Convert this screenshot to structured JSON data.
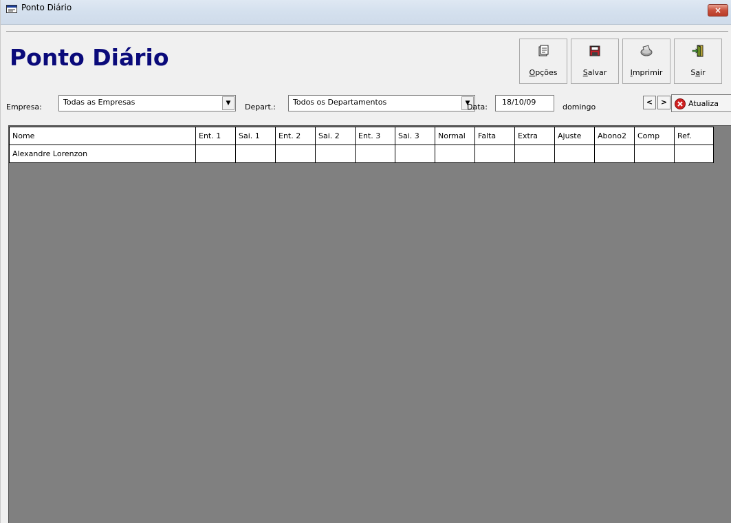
{
  "window": {
    "title": "Ponto Diário",
    "close_label": "×"
  },
  "header": {
    "title": "Ponto Diário",
    "title_color": "#0a0a7a"
  },
  "toolbar": {
    "options": {
      "label_first": "O",
      "label_rest": "pções",
      "icon": "document-gear-icon"
    },
    "save": {
      "label_first": "S",
      "label_rest": "alvar",
      "icon": "floppy-disk-icon"
    },
    "print": {
      "label_first": "I",
      "label_rest": "mprimir",
      "icon": "printer-icon"
    },
    "exit": {
      "label_pre": "S",
      "label_first": "a",
      "label_rest": "ir",
      "icon": "exit-door-icon"
    }
  },
  "filters": {
    "empresa_label": "Empresa:",
    "empresa_value": "Todas as Empresas",
    "depart_label": "Depart.:",
    "depart_value": "Todos os Departamentos",
    "data_label": "Data:",
    "data_value": "18/10/09",
    "weekday": "domingo",
    "prev_label": "<",
    "next_label": ">",
    "refresh_label": "Atualiza"
  },
  "grid": {
    "columns": [
      "Nome",
      "Ent. 1",
      "Sai. 1",
      "Ent. 2",
      "Sai. 2",
      "Ent. 3",
      "Sai. 3",
      "Normal",
      "Falta",
      "Extra",
      "Ajuste",
      "Abono2",
      "Comp",
      "Ref."
    ],
    "rows": [
      [
        "Alexandre Lorenzon",
        "",
        "",
        "",
        "",
        "",
        "",
        "",
        "",
        "",
        "",
        "",
        "",
        ""
      ]
    ]
  }
}
